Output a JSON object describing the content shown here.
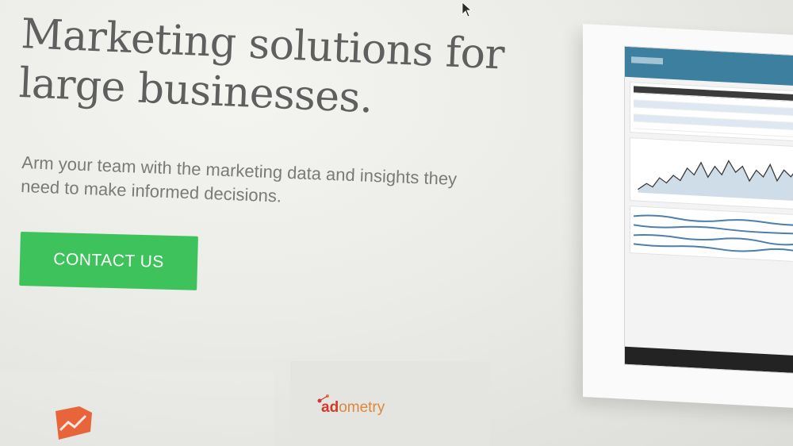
{
  "hero": {
    "headline_line1": "Marketing solutions for",
    "headline_line2": "large businesses.",
    "subheading_line1": "Arm your team with the marketing data and insights they",
    "subheading_line2": "need to make informed decisions.",
    "cta_label": "CONTACT US"
  },
  "partners": {
    "adometry_ad": "ad",
    "adometry_rest": "ometry"
  },
  "icons": [
    "mouse-cursor-icon",
    "google-analytics-icon",
    "adometry-atom-icon"
  ],
  "colors": {
    "cta": "#3ec25c",
    "headline": "#5f5f5f",
    "subheading": "#7a7a7a",
    "dashboard_header": "#3d7f9f",
    "adometry_red": "#cf3a2a",
    "adometry_orange": "#e0873a",
    "analytics_orange": "#e8643a"
  }
}
